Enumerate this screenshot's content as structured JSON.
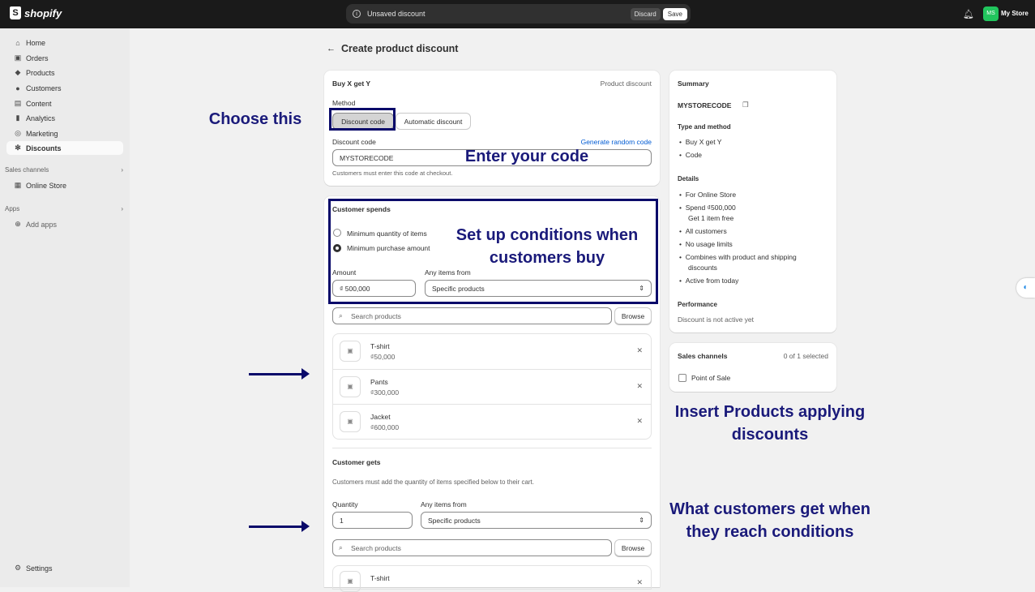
{
  "topbar": {
    "logo_text": "shopify",
    "unsaved_text": "Unsaved discount",
    "discard_label": "Discard",
    "save_label": "Save",
    "avatar_initials": "MS",
    "store_name": "My Store"
  },
  "sidebar": {
    "items": [
      {
        "label": "Home",
        "icon": "home-icon"
      },
      {
        "label": "Orders",
        "icon": "orders-icon"
      },
      {
        "label": "Products",
        "icon": "tag-icon"
      },
      {
        "label": "Customers",
        "icon": "person-icon"
      },
      {
        "label": "Content",
        "icon": "content-icon"
      },
      {
        "label": "Analytics",
        "icon": "bar-chart-icon"
      },
      {
        "label": "Marketing",
        "icon": "marketing-icon"
      },
      {
        "label": "Discounts",
        "icon": "discount-icon"
      }
    ],
    "sales_channels_label": "Sales channels",
    "online_store_label": "Online Store",
    "apps_label": "Apps",
    "add_apps_label": "Add apps",
    "settings_label": "Settings"
  },
  "page": {
    "title": "Create product discount"
  },
  "discount_card": {
    "title": "Buy X get Y",
    "type_label": "Product discount",
    "method_label": "Method",
    "method_code": "Discount code",
    "method_auto": "Automatic discount",
    "code_label": "Discount code",
    "generate_link": "Generate random code",
    "code_value": "MYSTORECODE",
    "code_help": "Customers must enter this code at checkout."
  },
  "spends_card": {
    "title": "Customer spends",
    "opt_min_qty": "Minimum quantity of items",
    "opt_min_amount": "Minimum purchase amount",
    "amount_label": "Amount",
    "amount_currency": "₫",
    "amount_value": "500,000",
    "any_items_label": "Any items from",
    "any_items_value": "Specific products",
    "search_placeholder": "Search products",
    "browse_label": "Browse",
    "products": [
      {
        "name": "T-shirt",
        "price": "₫50,000"
      },
      {
        "name": "Pants",
        "price": "₫300,000"
      },
      {
        "name": "Jacket",
        "price": "₫600,000"
      }
    ]
  },
  "gets_card": {
    "title": "Customer gets",
    "help": "Customers must add the quantity of items specified below to their cart.",
    "quantity_label": "Quantity",
    "quantity_value": "1",
    "any_items_label": "Any items from",
    "any_items_value": "Specific products",
    "search_placeholder": "Search products",
    "browse_label": "Browse",
    "first_product": "T-shirt"
  },
  "summary": {
    "title": "Summary",
    "code": "MYSTORECODE",
    "type_heading": "Type and method",
    "type_items": [
      "Buy X get Y",
      "Code"
    ],
    "details_heading": "Details",
    "details_items": [
      "For Online Store",
      "Spend ₫500,000",
      "Get 1 item free",
      "All customers",
      "No usage limits",
      "Combines with product and shipping",
      "discounts",
      "Active from today"
    ],
    "performance_heading": "Performance",
    "performance_text": "Discount is not active yet"
  },
  "sales_channels": {
    "title": "Sales channels",
    "count": "0 of 1 selected",
    "item": "Point of Sale"
  },
  "annotations": {
    "choose": "Choose this",
    "enter_code": "Enter your code",
    "conditions_1": "Set up conditions when",
    "conditions_2": "customers buy",
    "insert_1": "Insert Products applying",
    "insert_2": "discounts",
    "get_1": "What customers get when",
    "get_2": "they reach conditions"
  }
}
